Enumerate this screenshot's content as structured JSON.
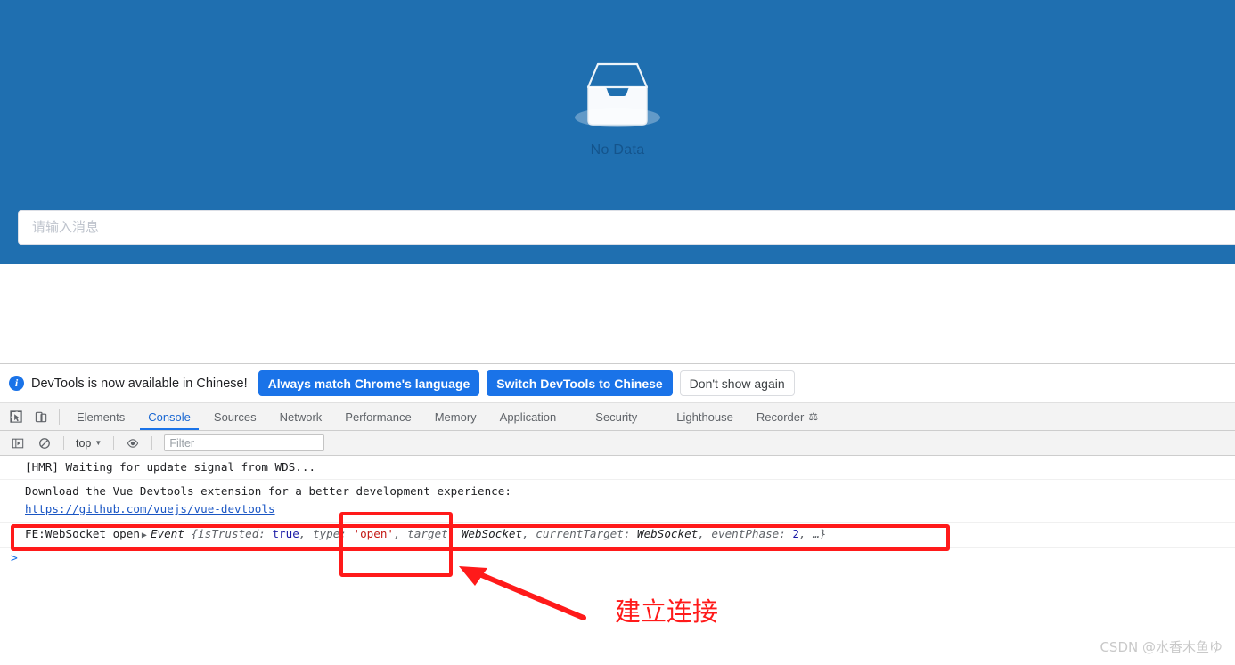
{
  "app": {
    "background_color": "#1f6fb0",
    "empty_state": {
      "icon": "inbox-tray-icon",
      "label": "No Data"
    },
    "message_input": {
      "placeholder": "请输入消息",
      "value": ""
    }
  },
  "devtools": {
    "banner": {
      "icon": "info-icon",
      "message": "DevTools is now available in Chinese!",
      "buttons": [
        {
          "label": "Always match Chrome's language",
          "style": "primary"
        },
        {
          "label": "Switch DevTools to Chinese",
          "style": "primary"
        },
        {
          "label": "Don't show again",
          "style": "secondary"
        }
      ]
    },
    "toolbar_icons": [
      {
        "name": "inspect-element-icon"
      },
      {
        "name": "device-toolbar-icon"
      }
    ],
    "tabs": [
      {
        "label": "Elements",
        "active": false
      },
      {
        "label": "Console",
        "active": true
      },
      {
        "label": "Sources",
        "active": false
      },
      {
        "label": "Network",
        "active": false
      },
      {
        "label": "Performance",
        "active": false
      },
      {
        "label": "Memory",
        "active": false
      },
      {
        "label": "Application",
        "active": false
      },
      {
        "label": "Security",
        "active": false
      },
      {
        "label": "Lighthouse",
        "active": false
      },
      {
        "label": "Recorder",
        "active": false,
        "badge": "experimental-flask-icon"
      }
    ],
    "console_toolbar": {
      "sidebar_icon": "console-sidebar-icon",
      "clear_icon": "clear-console-icon",
      "context": "top",
      "eye_icon": "live-expression-icon",
      "filter_placeholder": "Filter"
    },
    "console_rows": [
      {
        "id": "hmr",
        "text": "[HMR] Waiting for update signal from WDS..."
      },
      {
        "id": "vue-devtools",
        "text": "Download the Vue Devtools extension for a better development experience:",
        "link": "https://github.com/vuejs/vue-devtools"
      },
      {
        "id": "websocket-open",
        "prefix": "FE:WebSocket open",
        "disclosure": "▶",
        "object_name": "Event",
        "props": [
          {
            "key": "isTrusted",
            "value": "true",
            "value_kind": "boolean"
          },
          {
            "key": "type",
            "value": "'open'",
            "value_kind": "string"
          },
          {
            "key": "target",
            "value": "WebSocket",
            "value_kind": "object"
          },
          {
            "key": "currentTarget",
            "value": "WebSocket",
            "value_kind": "object"
          },
          {
            "key": "eventPhase",
            "value": "2",
            "value_kind": "number"
          }
        ],
        "ellipsis": "…"
      }
    ],
    "prompt": ">"
  },
  "annotations": {
    "color": "#ff1a1a",
    "outer_box_target": "websocket-open-row",
    "inner_box_target": "type-open-property",
    "callout_text": "建立连接",
    "arrow": "red-arrow-pointing-up-left"
  },
  "watermark": "CSDN @水香木鱼ゆ"
}
